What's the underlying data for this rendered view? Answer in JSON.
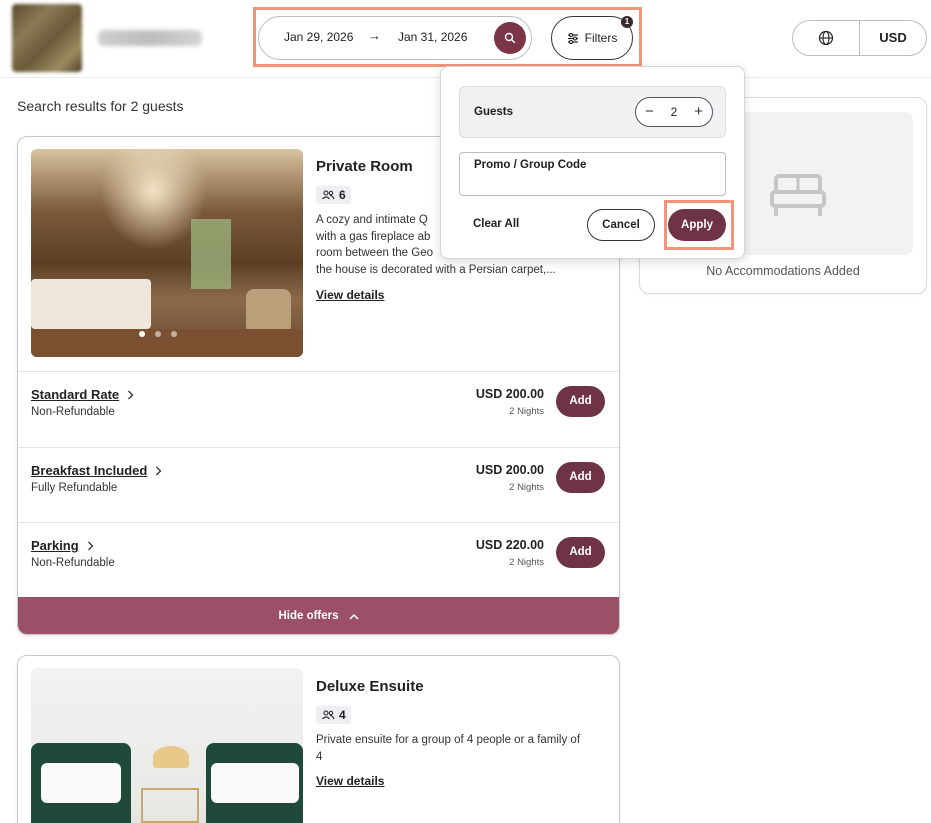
{
  "header": {
    "date_from": "Jan 29, 2026",
    "date_arrow": "→",
    "date_to": "Jan 31, 2026",
    "filters_label": "Filters",
    "filters_badge": "1",
    "currency": "USD"
  },
  "results_label": "Search results for 2 guests",
  "filters_panel": {
    "guests_label": "Guests",
    "guests_value": "2",
    "minus": "−",
    "plus": "+",
    "promo_label": "Promo / Group Code",
    "promo_value": "",
    "clear_all": "Clear All",
    "cancel": "Cancel",
    "apply": "Apply"
  },
  "rooms": [
    {
      "title": "Private Room",
      "guests": "6",
      "description": "A cozy and intimate Q... with a gas fireplace a... room between the Ge... the house is decorated with a Persian carpet,...",
      "description_lines": [
        "A cozy and intimate Q",
        "with a gas fireplace ab",
        "room between the Geo",
        "the house is decorated with a Persian carpet,..."
      ],
      "view_details": "View details",
      "offers": [
        {
          "name": "Standard Rate",
          "policy": "Non-Refundable",
          "price": "USD 200.00",
          "nights": "2 Nights",
          "add": "Add"
        },
        {
          "name": "Breakfast Included",
          "policy": "Fully Refundable",
          "price": "USD 200.00",
          "nights": "2 Nights",
          "add": "Add"
        },
        {
          "name": "Parking",
          "policy": "Non-Refundable",
          "price": "USD 220.00",
          "nights": "2 Nights",
          "add": "Add"
        }
      ],
      "hide_offers": "Hide offers"
    },
    {
      "title": "Deluxe Ensuite",
      "guests": "4",
      "description_lines": [
        "Private ensuite for a group of 4 people or a family of",
        "4"
      ],
      "view_details": "View details"
    }
  ],
  "summary": {
    "empty_text": "No Accommodations Added"
  },
  "colors": {
    "brand": "#6e3446",
    "hide_offers_bg": "#9b5068",
    "highlight": "#f0957a"
  },
  "icons": [
    "search-icon",
    "sliders-icon",
    "globe-icon",
    "arrow-right-icon",
    "guests-icon",
    "chevron-right-icon",
    "chevron-up-icon",
    "bed-icon"
  ]
}
